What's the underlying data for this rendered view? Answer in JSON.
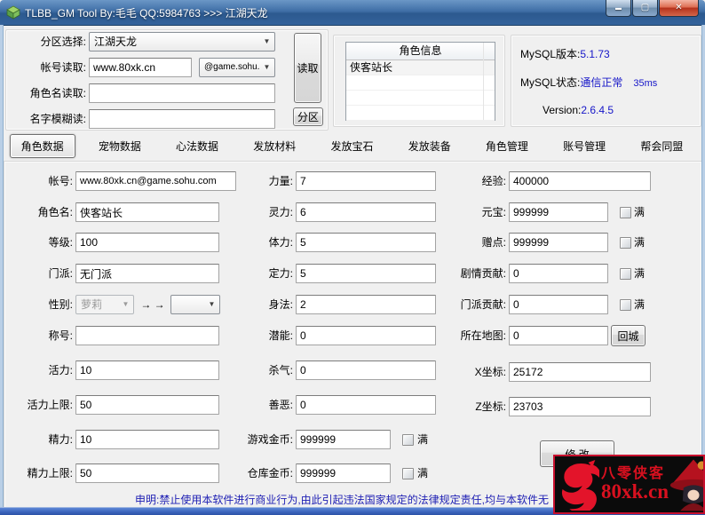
{
  "window": {
    "title": "TLBB_GM Tool By:毛毛 QQ:5984763 >>> 江湖天龙",
    "minimize_glyph": "▬",
    "maximize_glyph": "▢",
    "close_glyph": "✕"
  },
  "reader": {
    "partition_label": "分区选择:",
    "partition_value": "江湖天龙",
    "account_label": "帐号读取:",
    "account_value": "www.80xk.cn",
    "domain_value": "@game.sohu.com",
    "rolename_label": "角色名读取:",
    "rolename_value": "",
    "fuzzy_label": "名字模糊读:",
    "fuzzy_value": "",
    "read_button": "读取",
    "partition_button": "分区"
  },
  "char_info": {
    "header": "角色信息",
    "rows": [
      "侠客站长",
      "",
      "",
      ""
    ]
  },
  "status": {
    "mysql_version_label": "MySQL版本:",
    "mysql_version": "5.1.73",
    "mysql_state_label": "MySQL状态:",
    "mysql_state": "通信正常",
    "latency": "35ms",
    "tool_version_label": "Version:",
    "tool_version": "2.6.4.5"
  },
  "tabs": [
    {
      "label": "角色数据",
      "active": true
    },
    {
      "label": "宠物数据"
    },
    {
      "label": "心法数据"
    },
    {
      "label": "发放材料"
    },
    {
      "label": "发放宝石"
    },
    {
      "label": "发放装备"
    },
    {
      "label": "角色管理"
    },
    {
      "label": "账号管理"
    },
    {
      "label": "帮会同盟"
    }
  ],
  "form": {
    "full_label": "满",
    "left": [
      {
        "label": "帐号:",
        "value": "www.80xk.cn@game.sohu.com"
      },
      {
        "label": "角色名:",
        "value": "侠客站长"
      },
      {
        "label": "等级:",
        "value": "100"
      },
      {
        "label": "门派:",
        "value": "无门派"
      },
      {
        "label": "性别:",
        "combo1": "萝莉",
        "arrows": "→ →",
        "combo2": ""
      },
      {
        "label": "称号:",
        "value": ""
      },
      {
        "label": "活力:",
        "value": "10"
      },
      {
        "label": "活力上限:",
        "value": "50"
      },
      {
        "label": "精力:",
        "value": "10"
      },
      {
        "label": "精力上限:",
        "value": "50"
      }
    ],
    "middle": [
      {
        "label": "力量:",
        "value": "7"
      },
      {
        "label": "灵力:",
        "value": "6"
      },
      {
        "label": "体力:",
        "value": "5"
      },
      {
        "label": "定力:",
        "value": "5"
      },
      {
        "label": "身法:",
        "value": "2"
      },
      {
        "label": "潜能:",
        "value": "0"
      },
      {
        "label": "杀气:",
        "value": "0"
      },
      {
        "label": "善恶:",
        "value": "0"
      },
      {
        "label": "游戏金币:",
        "value": "999999"
      },
      {
        "label": "仓库金币:",
        "value": "999999"
      }
    ],
    "right": [
      {
        "label": "经验:",
        "value": "400000"
      },
      {
        "label": "元宝:",
        "value": "999999"
      },
      {
        "label": "赠点:",
        "value": "999999"
      },
      {
        "label": "剧情贡献:",
        "value": "0"
      },
      {
        "label": "门派贡献:",
        "value": "0"
      },
      {
        "label": "所在地图:",
        "value": "0"
      },
      {
        "label": "X坐标:",
        "value": "25172"
      },
      {
        "label": "Z坐标:",
        "value": "23703"
      }
    ],
    "return_button": "回城",
    "modify_button": "修 改"
  },
  "footer": {
    "disclaimer": "申明:禁止使用本软件进行商业行为,由此引起违法国家规定的法律规定责任,均与本软件无"
  },
  "logo": {
    "title": "八零侠客",
    "domain": "80xk.cn"
  },
  "colors": {
    "status_blue": "#1515c8",
    "disclaimer_blue": "#2021b4",
    "logo_red": "#d8101f",
    "titlebar_blue": "#2c598f"
  }
}
